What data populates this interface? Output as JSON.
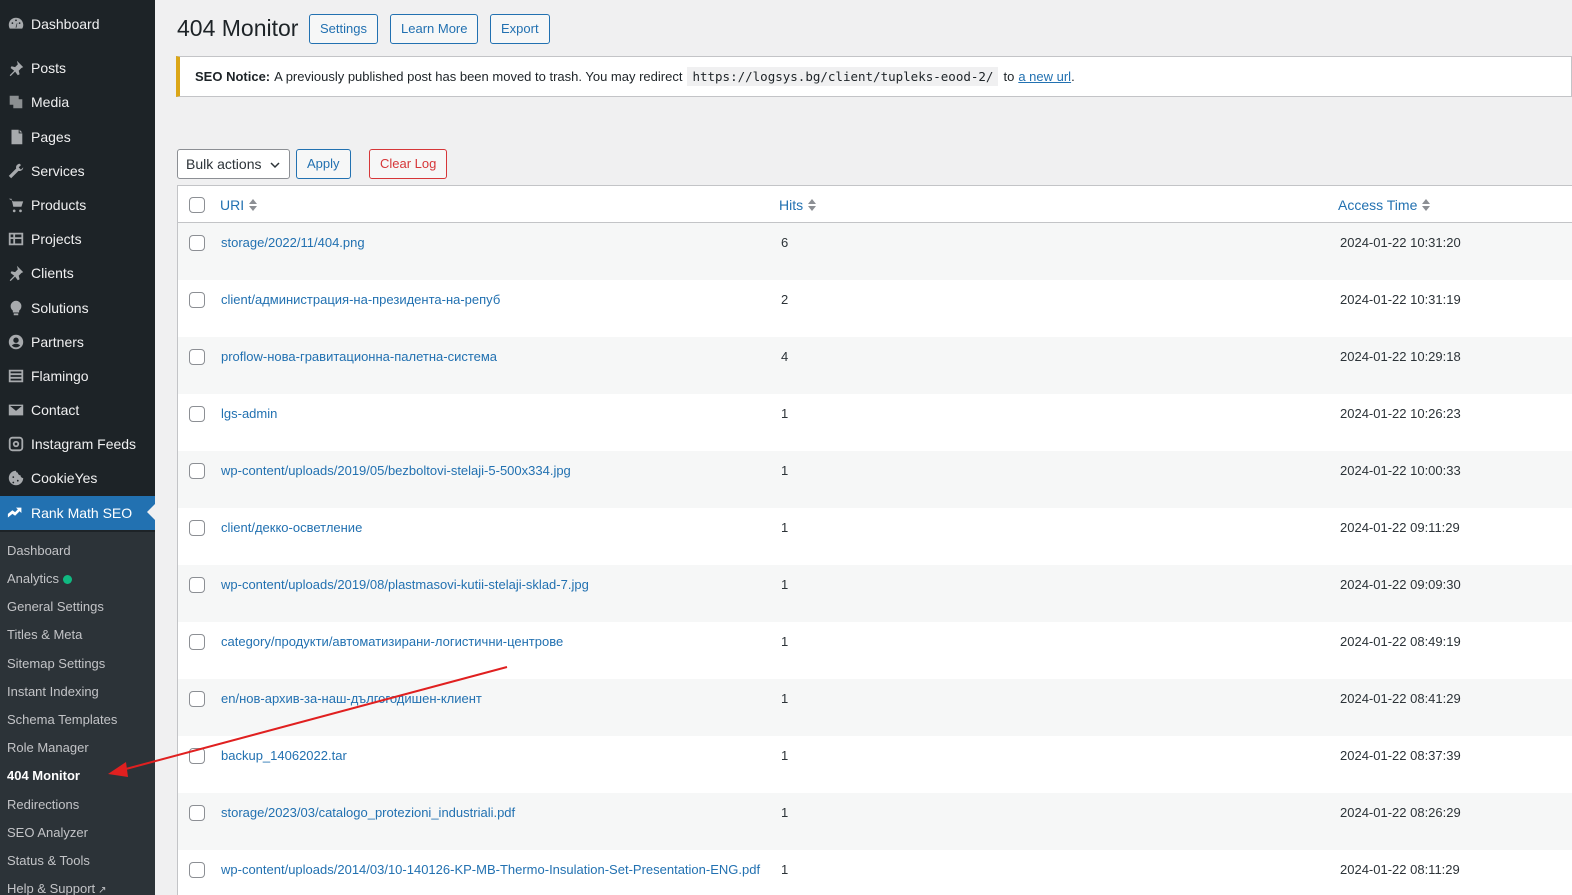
{
  "sidebar": {
    "items": [
      {
        "label": "Dashboard",
        "icon": "dashboard-icon"
      },
      {
        "label": "Posts",
        "icon": "pin-icon"
      },
      {
        "label": "Media",
        "icon": "media-icon"
      },
      {
        "label": "Pages",
        "icon": "pages-icon"
      },
      {
        "label": "Services",
        "icon": "wrench-icon"
      },
      {
        "label": "Products",
        "icon": "cart-icon"
      },
      {
        "label": "Projects",
        "icon": "grid-icon"
      },
      {
        "label": "Clients",
        "icon": "pin-icon"
      },
      {
        "label": "Solutions",
        "icon": "lightbulb-icon"
      },
      {
        "label": "Partners",
        "icon": "user-circle-icon"
      },
      {
        "label": "Flamingo",
        "icon": "list-icon"
      },
      {
        "label": "Contact",
        "icon": "mail-icon"
      },
      {
        "label": "Instagram Feeds",
        "icon": "instagram-icon"
      },
      {
        "label": "CookieYes",
        "icon": "cookie-icon"
      },
      {
        "label": "Rank Math SEO",
        "icon": "rankmath-icon"
      }
    ],
    "submenu": [
      {
        "label": "Dashboard"
      },
      {
        "label": "Analytics"
      },
      {
        "label": "General Settings"
      },
      {
        "label": "Titles & Meta"
      },
      {
        "label": "Sitemap Settings"
      },
      {
        "label": "Instant Indexing"
      },
      {
        "label": "Schema Templates"
      },
      {
        "label": "Role Manager"
      },
      {
        "label": "404 Monitor"
      },
      {
        "label": "Redirections"
      },
      {
        "label": "SEO Analyzer"
      },
      {
        "label": "Status & Tools"
      },
      {
        "label": "Help & Support"
      }
    ]
  },
  "header": {
    "title": "404 Monitor",
    "buttons": {
      "settings": "Settings",
      "learn_more": "Learn More",
      "export": "Export"
    }
  },
  "notice": {
    "label": "SEO Notice:",
    "text": "A previously published post has been moved to trash. You may redirect",
    "url": "https://logsys.bg/client/tupleks-eood-2/",
    "to": "to",
    "link": "a new url",
    "end": "."
  },
  "bulk": {
    "select": "Bulk actions",
    "apply": "Apply",
    "clear": "Clear Log"
  },
  "table": {
    "columns": {
      "uri": "URI",
      "hits": "Hits",
      "time": "Access Time"
    },
    "rows": [
      {
        "uri": "storage/2022/11/404.png",
        "hits": "6",
        "time": "2024-01-22 10:31:20"
      },
      {
        "uri": "client/администрация-на-президента-на-репуб",
        "hits": "2",
        "time": "2024-01-22 10:31:19"
      },
      {
        "uri": "proflow-нова-гравитационна-палетна-система",
        "hits": "4",
        "time": "2024-01-22 10:29:18"
      },
      {
        "uri": "lgs-admin",
        "hits": "1",
        "time": "2024-01-22 10:26:23"
      },
      {
        "uri": "wp-content/uploads/2019/05/bezboltovi-stelaji-5-500x334.jpg",
        "hits": "1",
        "time": "2024-01-22 10:00:33"
      },
      {
        "uri": "client/декко-осветление",
        "hits": "1",
        "time": "2024-01-22 09:11:29"
      },
      {
        "uri": "wp-content/uploads/2019/08/plastmasovi-kutii-stelaji-sklad-7.jpg",
        "hits": "1",
        "time": "2024-01-22 09:09:30"
      },
      {
        "uri": "category/продукти/автоматизирани-логистични-центрове",
        "hits": "1",
        "time": "2024-01-22 08:49:19"
      },
      {
        "uri": "en/нов-архив-за-наш-дългогодишен-клиент",
        "hits": "1",
        "time": "2024-01-22 08:41:29"
      },
      {
        "uri": "backup_14062022.tar",
        "hits": "1",
        "time": "2024-01-22 08:37:39"
      },
      {
        "uri": "storage/2023/03/catalogo_protezioni_industriali.pdf",
        "hits": "1",
        "time": "2024-01-22 08:26:29"
      },
      {
        "uri": "wp-content/uploads/2014/03/10-140126-KP-MB-Thermo-Insulation-Set-Presentation-ENG.pdf",
        "hits": "1",
        "time": "2024-01-22 08:11:29"
      }
    ]
  },
  "colors": {
    "accent": "#2271b1",
    "sidebar_bg": "#1d2327",
    "notice_border": "#dba617",
    "danger": "#d63638",
    "annotation": "#e02020"
  }
}
